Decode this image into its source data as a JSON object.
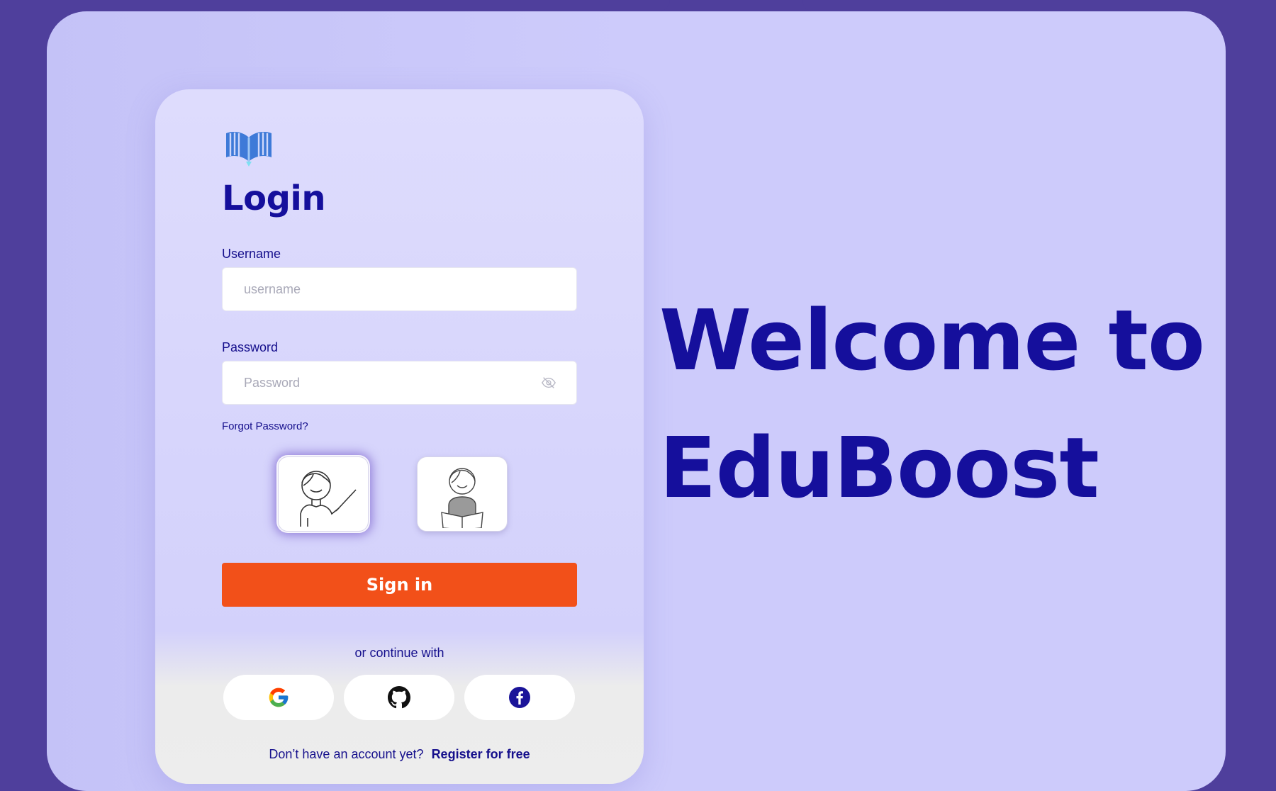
{
  "login": {
    "title": "Login",
    "username_label": "Username",
    "username_placeholder": "username",
    "password_label": "Password",
    "password_placeholder": "Password",
    "forgot_password": "Forgot Password?",
    "roles": [
      {
        "name": "teacher",
        "selected": true
      },
      {
        "name": "student",
        "selected": false
      }
    ],
    "signin_label": "Sign in",
    "or_continue": "or continue with",
    "socials": [
      "google-icon",
      "github-icon",
      "facebook-icon"
    ],
    "no_account": "Don’t have an account yet?",
    "register_link": "Register for free"
  },
  "welcome": {
    "line1": "Welcome to",
    "line2": "EduBoost"
  },
  "colors": {
    "primary": "#150f9c",
    "accent": "#f25019",
    "background": "#4f3f9c",
    "panel": "#cdcbfb"
  }
}
